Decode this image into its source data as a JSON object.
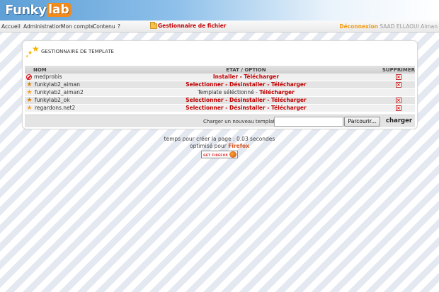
{
  "app": {
    "logo_text": "Funky",
    "logo_accent": "lab"
  },
  "nav": {
    "items": [
      "Accueil",
      "Administration",
      "Mon compte",
      "Contenu",
      "?"
    ],
    "file_manager_label": "Gestionnaire de fichier",
    "logout_label": "Déconnexion",
    "user_name": "SAAD ELLAOUI Aiman"
  },
  "panel": {
    "title": "GESTIONNAIRE DE TEMPLATE",
    "columns": {
      "name": "NOM",
      "status": "ETAT / OPTION",
      "delete": "SUPPRIMER"
    },
    "rows": [
      {
        "name": "medprobis",
        "icon": "forbidden-icon",
        "status_parts": [
          {
            "text": "Installer",
            "type": "action"
          },
          {
            "text": " - ",
            "type": "action"
          },
          {
            "text": "Télécharger",
            "type": "action"
          }
        ]
      },
      {
        "name": "funkylab2_aiman",
        "icon": "star-icon",
        "status_parts": [
          {
            "text": "Selectionner",
            "type": "action"
          },
          {
            "text": " - ",
            "type": "action"
          },
          {
            "text": "Désinstaller",
            "type": "action"
          },
          {
            "text": " - ",
            "type": "action"
          },
          {
            "text": "Télécharger",
            "type": "action"
          }
        ]
      },
      {
        "name": "funkylab2_aiman2",
        "icon": "star-icon",
        "status_parts": [
          {
            "text": "Template séléctionné - ",
            "type": "plain"
          },
          {
            "text": "Télécharger",
            "type": "action"
          }
        ]
      },
      {
        "name": "funkylab2_ok",
        "icon": "star-icon",
        "status_parts": [
          {
            "text": "Selectionner",
            "type": "action"
          },
          {
            "text": " - ",
            "type": "action"
          },
          {
            "text": "Désinstaller",
            "type": "action"
          },
          {
            "text": " - ",
            "type": "action"
          },
          {
            "text": "Télécharger",
            "type": "action"
          }
        ]
      },
      {
        "name": "regardons.net2",
        "icon": "star-icon",
        "status_parts": [
          {
            "text": "Selectionner",
            "type": "action"
          },
          {
            "text": " - ",
            "type": "action"
          },
          {
            "text": "Désinstaller",
            "type": "action"
          },
          {
            "text": " - ",
            "type": "action"
          },
          {
            "text": "Télécharger",
            "type": "action"
          }
        ]
      }
    ],
    "delete_visible": [
      true,
      true,
      false,
      true,
      true
    ],
    "upload": {
      "label": "Charger un nouveau template",
      "file_value": "",
      "browse_label": "Parcourir...",
      "submit_label": "charger"
    }
  },
  "footer": {
    "render_time": "temps pour créer la page : 0.03 secondes",
    "optimized_prefix": "optimisé pour",
    "optimized_browser": "Firefox",
    "badge_text": "GET FIREFOX"
  },
  "colors": {
    "accent_red": "#c30000",
    "logout_orange": "#f29b12",
    "logo_orange": "#f28a1c"
  }
}
